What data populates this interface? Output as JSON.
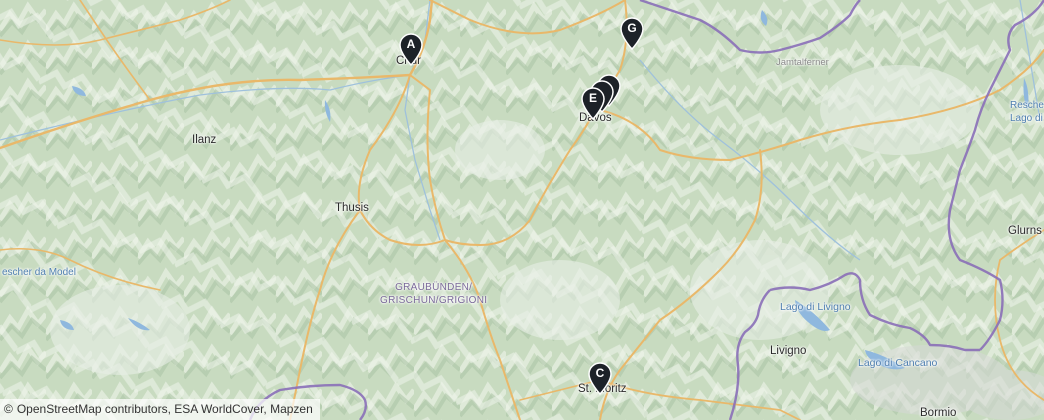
{
  "map": {
    "attribution": "OpenStreetMap contributors, ESA WorldCover, Mapzen",
    "attribution_symbol": "©",
    "places": {
      "chur": "Chur",
      "ilanz": "Ilanz",
      "thusis": "Thusis",
      "davos": "Davos",
      "st_moritz": "St. Moritz",
      "livigno": "Livigno",
      "lago_livigno": "Lago di Livigno",
      "lago_cancano": "Lago di Cancano",
      "glurns": "Glurns",
      "bormio": "Bormio",
      "jamtalferner": "Jamtalferner",
      "region_line1": "GRAUBÜNDEN/",
      "region_line2": "GRISCHUN/GRIGIONI",
      "reschen_line1": "Rescher",
      "reschen_line2": "Lago di",
      "model": "escher da Model"
    },
    "markers": [
      {
        "id": "A",
        "label": "A"
      },
      {
        "id": "C",
        "label": "C"
      },
      {
        "id": "D",
        "label": ""
      },
      {
        "id": "B",
        "label": ""
      },
      {
        "id": "E",
        "label": "E"
      },
      {
        "id": "G",
        "label": "G"
      }
    ],
    "colors": {
      "land": "#c9dcc2",
      "road": "#e9b86a",
      "border": "#8a6fb8",
      "water": "#8fb8de",
      "marker": "#1d2228"
    }
  }
}
